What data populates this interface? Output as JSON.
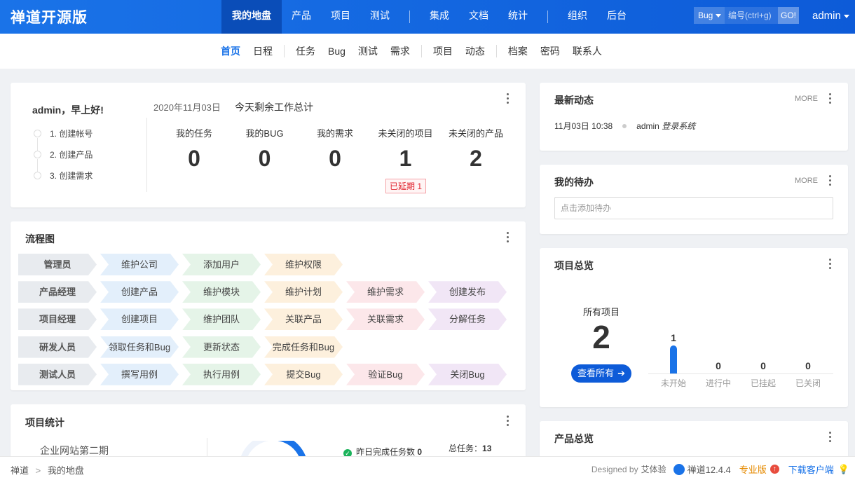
{
  "brand": "禅道开源版",
  "main_nav": [
    {
      "label": "我的地盘",
      "active": true
    },
    {
      "label": "产品"
    },
    {
      "label": "项目"
    },
    {
      "label": "测试"
    },
    {
      "sep": true
    },
    {
      "label": "集成"
    },
    {
      "label": "文档"
    },
    {
      "label": "统计"
    },
    {
      "sep": true
    },
    {
      "label": "组织"
    },
    {
      "label": "后台"
    }
  ],
  "search": {
    "type": "Bug",
    "placeholder": "编号(ctrl+g)",
    "go": "GO!"
  },
  "user": "admin",
  "sub_nav": [
    {
      "label": "首页",
      "active": true
    },
    {
      "label": "日程"
    },
    {
      "sep": true
    },
    {
      "label": "任务"
    },
    {
      "label": "Bug"
    },
    {
      "label": "测试"
    },
    {
      "label": "需求"
    },
    {
      "sep": true
    },
    {
      "label": "项目"
    },
    {
      "label": "动态"
    },
    {
      "sep": true
    },
    {
      "label": "档案"
    },
    {
      "label": "密码"
    },
    {
      "label": "联系人"
    }
  ],
  "welcome": {
    "greeting": "admin，早上好!",
    "steps": [
      "1. 创建帐号",
      "2. 创建产品",
      "3. 创建需求"
    ],
    "date": "2020年11月03日",
    "title": "今天剩余工作总计",
    "stats": [
      {
        "label": "我的任务",
        "value": "0"
      },
      {
        "label": "我的BUG",
        "value": "0"
      },
      {
        "label": "我的需求",
        "value": "0"
      },
      {
        "label": "未关闭的项目",
        "value": "1"
      },
      {
        "label": "未关闭的产品",
        "value": "2"
      }
    ],
    "delay_badge": "已延期 1"
  },
  "flow": {
    "title": "流程图",
    "rows": [
      {
        "role": "管理员",
        "steps": [
          "维护公司",
          "添加用户",
          "维护权限"
        ]
      },
      {
        "role": "产品经理",
        "steps": [
          "创建产品",
          "维护模块",
          "维护计划",
          "维护需求",
          "创建发布"
        ]
      },
      {
        "role": "项目经理",
        "steps": [
          "创建项目",
          "维护团队",
          "关联产品",
          "关联需求",
          "分解任务"
        ]
      },
      {
        "role": "研发人员",
        "steps": [
          "领取任务和Bug",
          "更新状态",
          "完成任务和Bug"
        ]
      },
      {
        "role": "测试人员",
        "steps": [
          "撰写用例",
          "执行用例",
          "提交Bug",
          "验证Bug",
          "关闭Bug"
        ]
      }
    ],
    "colors": {
      "role": "#e8ebef",
      "c1": "#e3effb",
      "c2": "#e5f4e8",
      "c3": "#fdf0dd",
      "c4": "#fce7ea",
      "c5": "#f1e6f6"
    }
  },
  "project_stats": {
    "title": "项目统计",
    "project_name": "企业网站第二期",
    "yesterday_done_label": "昨日完成任务数",
    "yesterday_done": "0",
    "total_tasks_label": "总任务：",
    "total_tasks": "13"
  },
  "dynamics": {
    "title": "最新动态",
    "more": "MORE",
    "items": [
      {
        "time": "11月03日 10:38",
        "actor": "admin",
        "action": "登录系统"
      }
    ]
  },
  "todo": {
    "title": "我的待办",
    "more": "MORE",
    "placeholder": "点击添加待办"
  },
  "project_overview": {
    "title": "项目总览",
    "all_label": "所有项目",
    "all_count": "2",
    "view_all": "查看所有",
    "bars": [
      {
        "label": "未开始",
        "value": 1
      },
      {
        "label": "进行中",
        "value": 0
      },
      {
        "label": "已挂起",
        "value": 0
      },
      {
        "label": "已关闭",
        "value": 0
      }
    ],
    "bar_color": "#1a73e8"
  },
  "product_overview": {
    "title": "产品总览"
  },
  "footer": {
    "breadcrumb": [
      "禅道",
      "我的地盘"
    ],
    "designed_by": "Designed by",
    "designer": "艾体验",
    "version": "禅道12.4.4",
    "pro": "专业版",
    "download": "下载客户端"
  }
}
